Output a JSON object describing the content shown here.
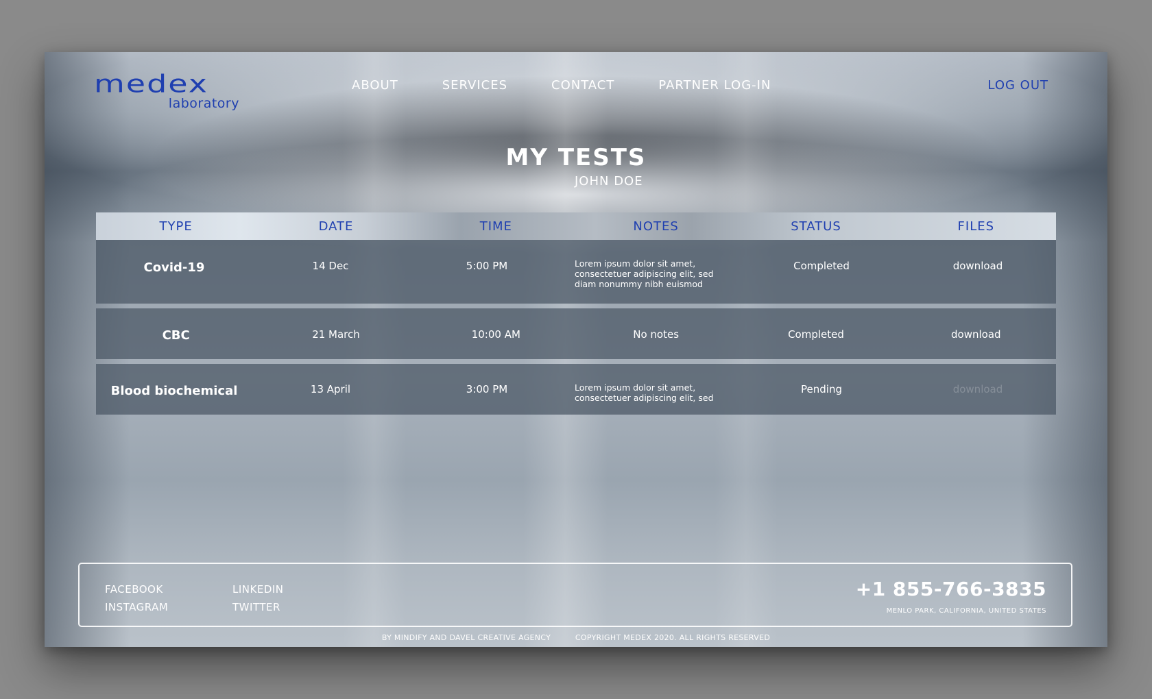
{
  "header": {
    "logo_main": "medex",
    "logo_sub": "laboratory",
    "nav": [
      {
        "label": "ABOUT"
      },
      {
        "label": "SERVICES"
      },
      {
        "label": "CONTACT"
      },
      {
        "label": "PARTNER LOG-IN"
      }
    ],
    "logout_label": "LOG OUT"
  },
  "page": {
    "title": "MY TESTS",
    "user_name": "JOHN DOE"
  },
  "table": {
    "columns": [
      "TYPE",
      "DATE",
      "TIME",
      "NOTES",
      "STATUS",
      "FILES"
    ],
    "rows": [
      {
        "type": "Covid-19",
        "date": "14 Dec",
        "time": "5:00 PM",
        "notes": "Lorem ipsum dolor sit amet, consectetuer adipiscing elit, sed diam nonummy nibh euismod",
        "status": "Completed",
        "file": "download"
      },
      {
        "type": "CBC",
        "date": "21 March",
        "time": "10:00 AM",
        "notes": "No notes",
        "status": "Completed",
        "file": "download"
      },
      {
        "type": "Blood biochemical",
        "date": "13 April",
        "time": "3:00 PM",
        "notes": "Lorem ipsum dolor sit amet, consectetuer adipiscing elit, sed",
        "status": "Pending",
        "file": "download"
      }
    ]
  },
  "footer": {
    "social": [
      {
        "label": "FACEBOOK"
      },
      {
        "label": "LINKEDIN"
      },
      {
        "label": "INSTAGRAM"
      },
      {
        "label": "TWITTER"
      }
    ],
    "phone": "+1 855-766-3835",
    "address": "MENLO PARK, CALIFORNIA, UNITED STATES",
    "credit_left": "BY MINDIFY AND DAVEL CREATIVE AGENCY",
    "credit_right": "COPYRIGHT MEDEX 2020. ALL RIGHTS RESERVED"
  },
  "colors": {
    "brand_blue": "#1f3fb0",
    "row_bg": "#4a5664",
    "text": "#ffffff"
  }
}
